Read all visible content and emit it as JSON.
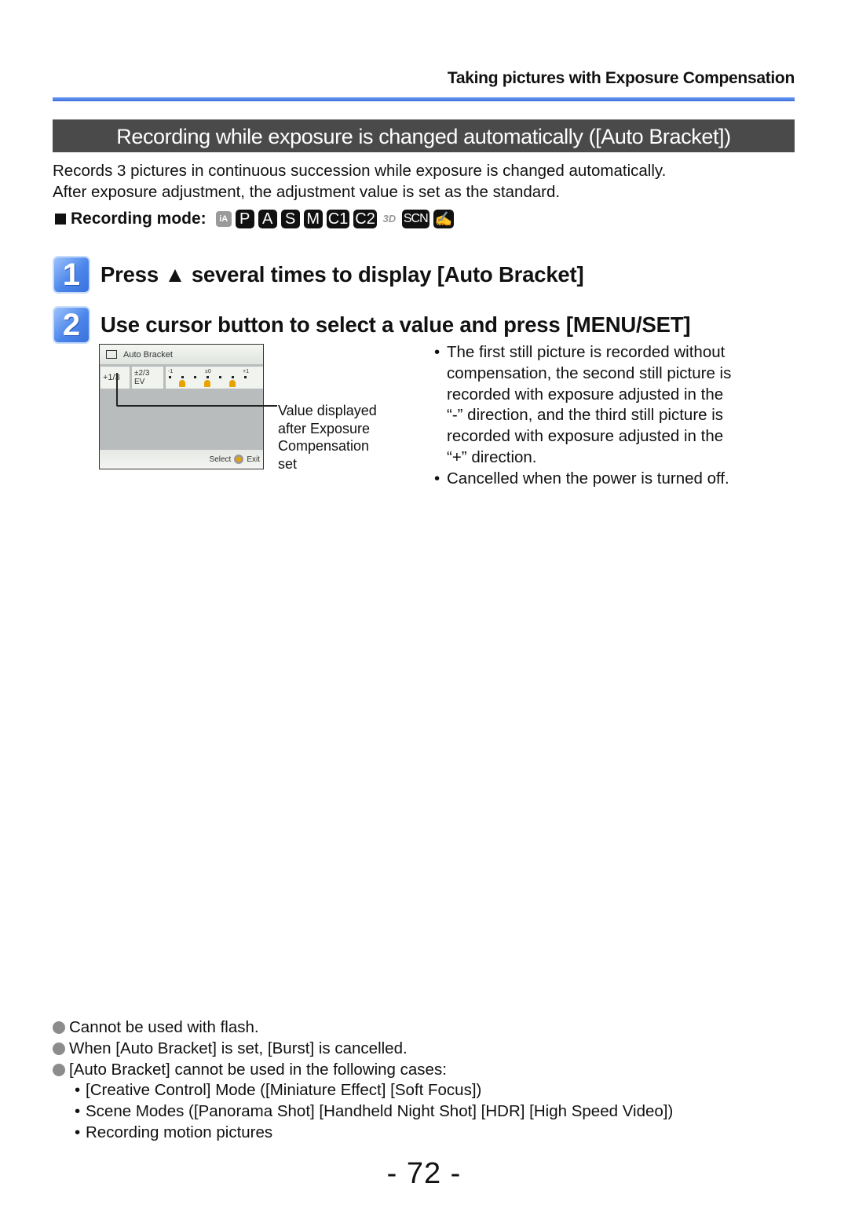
{
  "header": {
    "title": "Taking pictures with Exposure Compensation",
    "accent_color": "#3b6fe0"
  },
  "section": {
    "title": "Recording while exposure is changed automatically ([Auto Bracket])",
    "bar_color": "#4a4a4a"
  },
  "intro": {
    "line1": "Records 3 pictures in continuous succession while exposure is changed automatically.",
    "line2": "After exposure adjustment, the adjustment value is set as the standard."
  },
  "recording_mode": {
    "label": "Recording mode:",
    "modes": [
      "iA",
      "P",
      "A",
      "S",
      "M",
      "C1",
      "C2",
      "3D",
      "SCN",
      "✍"
    ]
  },
  "steps": [
    {
      "number": "1",
      "text": "Press ▲ several times to display [Auto Bracket]"
    },
    {
      "number": "2",
      "text": "Use cursor button to select a value and press [MENU/SET]"
    }
  ],
  "screen": {
    "title": "Auto Bracket",
    "value": "+1/3",
    "ev": "±2/3 EV",
    "scale_labels": [
      "-1",
      "±0",
      "+1"
    ],
    "select_label": "Select",
    "exit_label": "Exit"
  },
  "callout": {
    "line1": "Value displayed",
    "line2": "after Exposure",
    "line3": "Compensation",
    "line4": "set"
  },
  "notes": [
    {
      "lines": [
        "The first still picture is recorded without",
        "compensation, the second still picture is",
        "recorded with exposure adjusted in the",
        "“-” direction, and the third still picture is",
        "recorded with exposure adjusted in the",
        "“+” direction."
      ]
    },
    {
      "lines": [
        "Cancelled when the power is turned off."
      ]
    }
  ],
  "cautions": {
    "items": [
      "Cannot be used with flash.",
      "When [Auto Bracket] is set, [Burst] is cancelled.",
      "[Auto Bracket] cannot be used in the following cases:"
    ],
    "sub_items": [
      "[Creative Control] Mode ([Miniature Effect] [Soft Focus])",
      "Scene Modes ([Panorama Shot] [Handheld Night Shot] [HDR] [High Speed Video])",
      "Recording motion pictures"
    ]
  },
  "page_number": "- 72 -"
}
